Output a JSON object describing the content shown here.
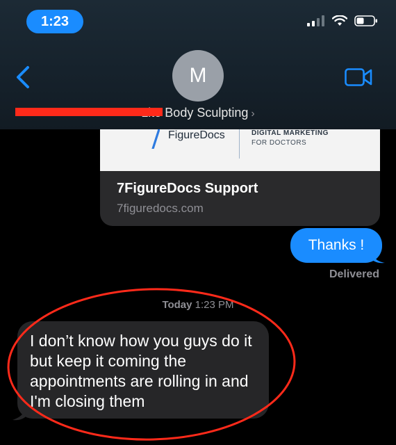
{
  "status_bar": {
    "time": "1:23"
  },
  "header": {
    "avatar_initial": "M",
    "contact_name": "Lite Body Sculpting",
    "chevron": "›"
  },
  "link_preview": {
    "logo_text": "FigureDocs",
    "tagline_1": "DIGITAL MARKETING",
    "tagline_2": "FOR DOCTORS",
    "title": "7FigureDocs Support",
    "url": "7figuredocs.com"
  },
  "messages": {
    "sent_text": "Thanks !",
    "sent_status": "Delivered",
    "timestamp_day": "Today",
    "timestamp_time": "1:23 PM",
    "received_text": "I don’t know how you guys do it but keep it coming the appointments are rolling in and I'm closing them"
  },
  "colors": {
    "accent_blue": "#1a8cff",
    "annotation_red": "#ff2a1a",
    "received_bubble": "#262628"
  },
  "icons": [
    "back-chevron-icon",
    "video-camera-icon",
    "signal-bars-icon",
    "wifi-icon",
    "battery-icon"
  ]
}
